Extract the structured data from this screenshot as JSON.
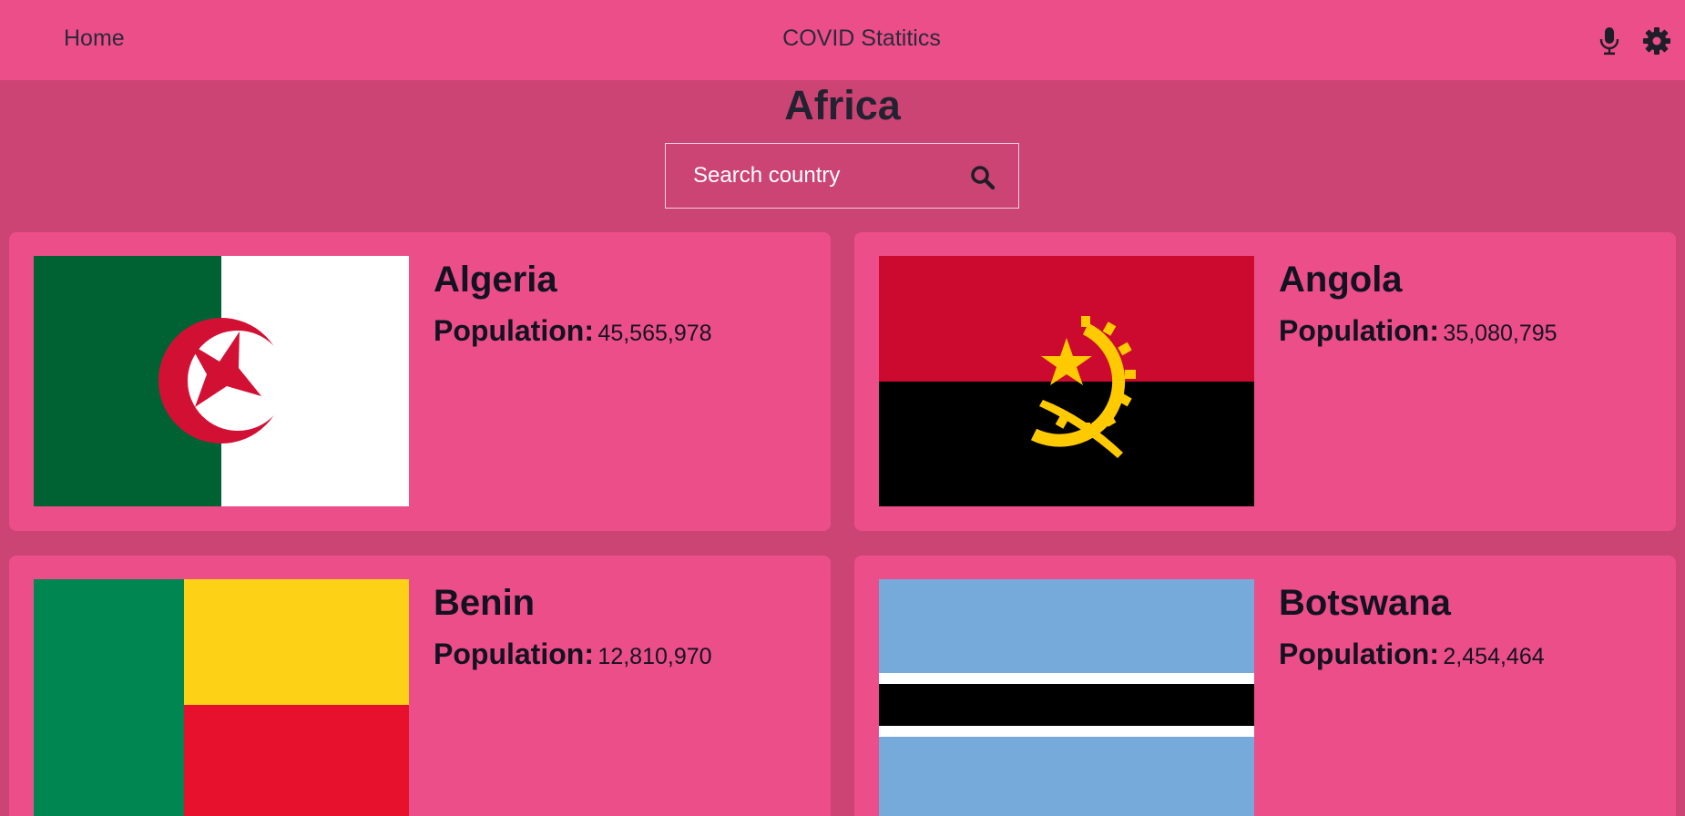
{
  "header": {
    "home_label": "Home",
    "app_title": "COVID Statitics",
    "icons": [
      "microphone-icon",
      "gear-icon"
    ]
  },
  "region": {
    "title": "Africa"
  },
  "search": {
    "placeholder": "Search country",
    "value": ""
  },
  "population_label": "Population:",
  "countries": [
    {
      "name": "Algeria",
      "population": "45,565,978",
      "flag": "algeria-flag"
    },
    {
      "name": "Angola",
      "population": "35,080,795",
      "flag": "angola-flag"
    },
    {
      "name": "Benin",
      "population": "12,810,970",
      "flag": "benin-flag"
    },
    {
      "name": "Botswana",
      "population": "2,454,464",
      "flag": "botswana-flag"
    }
  ],
  "colors": {
    "header_bg": "#ec4e89",
    "page_bg": "#cc4474",
    "card_bg": "#ec4e89"
  }
}
